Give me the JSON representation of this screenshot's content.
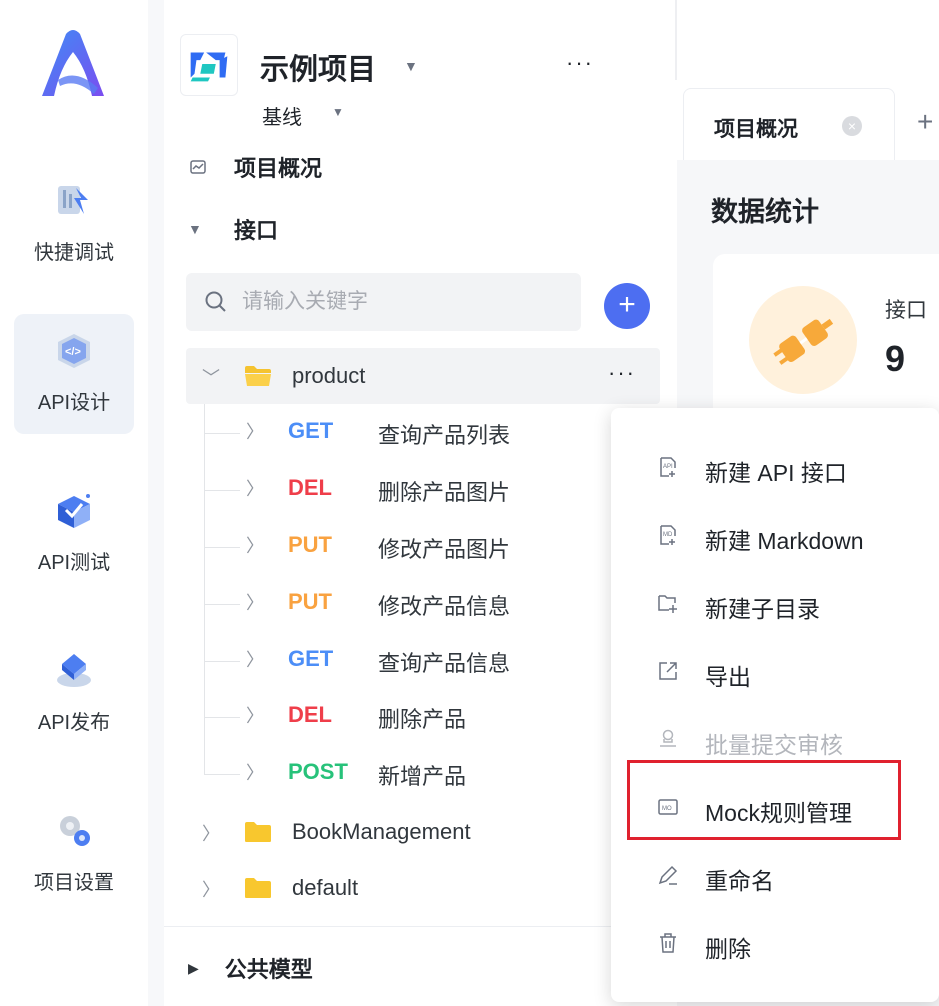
{
  "rail": {
    "items": [
      {
        "label": "快捷调试",
        "icon": "quick-debug-icon"
      },
      {
        "label": "API设计",
        "icon": "api-design-icon",
        "active": true
      },
      {
        "label": "API测试",
        "icon": "api-test-icon"
      },
      {
        "label": "API发布",
        "icon": "api-publish-icon"
      },
      {
        "label": "项目设置",
        "icon": "settings-gear-icon"
      }
    ]
  },
  "project": {
    "name": "示例项目",
    "more": "···",
    "baseline": "基线"
  },
  "nav": {
    "overview": "项目概况",
    "interfaces": "接口",
    "public_models": "公共模型"
  },
  "search": {
    "placeholder": "请输入关键字",
    "add_label": "+"
  },
  "tree": {
    "folders": [
      {
        "name": "product",
        "expanded": true,
        "more": "···"
      },
      {
        "name": "BookManagement",
        "expanded": false
      },
      {
        "name": "default",
        "expanded": false
      }
    ],
    "apis": [
      {
        "method": "GET",
        "name": "查询产品列表"
      },
      {
        "method": "DEL",
        "name": "删除产品图片"
      },
      {
        "method": "PUT",
        "name": "修改产品图片"
      },
      {
        "method": "PUT",
        "name": "修改产品信息"
      },
      {
        "method": "GET",
        "name": "查询产品信息"
      },
      {
        "method": "DEL",
        "name": "删除产品"
      },
      {
        "method": "POST",
        "name": "新增产品"
      }
    ]
  },
  "main": {
    "tab_label": "项目概况",
    "tab_add": "+",
    "stats_title": "数据统计",
    "stat_card": {
      "label": "接口",
      "value": "9"
    }
  },
  "context_menu": {
    "items": [
      {
        "label": "新建 API 接口",
        "icon": "new-api-icon"
      },
      {
        "label": "新建 Markdown",
        "icon": "new-markdown-icon"
      },
      {
        "label": "新建子目录",
        "icon": "new-subfolder-icon"
      },
      {
        "label": "导出",
        "icon": "export-icon"
      },
      {
        "label": "批量提交审核",
        "icon": "batch-review-icon",
        "disabled": true
      },
      {
        "label": "Mock规则管理",
        "icon": "mock-rules-icon",
        "highlighted": true
      },
      {
        "label": "重命名",
        "icon": "rename-pencil-icon"
      },
      {
        "label": "删除",
        "icon": "delete-trash-icon"
      }
    ]
  },
  "colors": {
    "accent": "#4d6ef1",
    "get": "#4c8ef7",
    "del": "#ef3e4a",
    "put": "#f9a240",
    "post": "#27c27a",
    "highlight_border": "#e0212f"
  }
}
